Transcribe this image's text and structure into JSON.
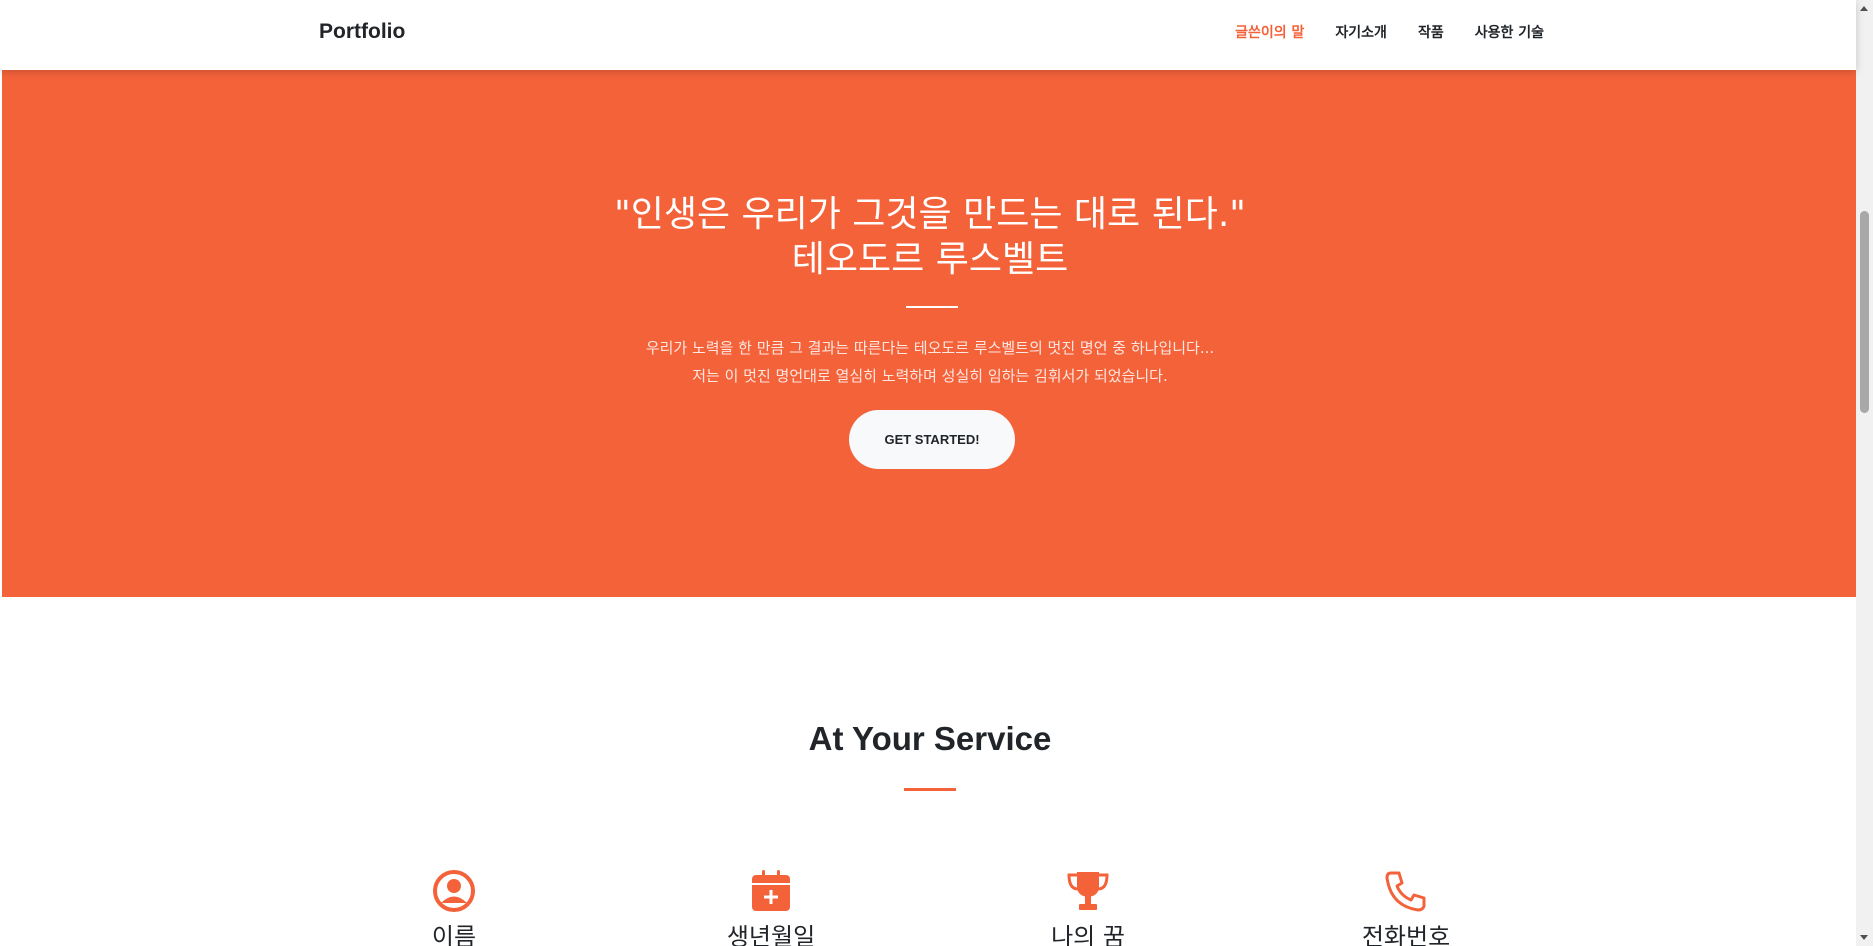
{
  "navbar": {
    "brand": "Portfolio",
    "links": [
      {
        "label": "글쓴이의 말",
        "active": true
      },
      {
        "label": "자기소개",
        "active": false
      },
      {
        "label": "작품",
        "active": false
      },
      {
        "label": "사용한 기술",
        "active": false
      }
    ]
  },
  "hero": {
    "title_line1": "\"인생은 우리가 그것을 만드는 대로 된다.\"",
    "title_line2": "테오도르 루스벨트",
    "text_line1": "우리가 노력을 한 만큼 그 결과는 따른다는 테오도르 루스벨트의 멋진 명언 중 하나입니다...",
    "text_line2": "저는 이 멋진 명언대로 열심히 노력하며 성실히 임하는 김휘서가 되었습니다.",
    "button_label": "GET STARTED!"
  },
  "services": {
    "title": "At Your Service",
    "items": [
      {
        "icon": "user-circle-icon",
        "label": "이름"
      },
      {
        "icon": "calendar-plus-icon",
        "label": "생년월일"
      },
      {
        "icon": "trophy-icon",
        "label": "나의 꿈"
      },
      {
        "icon": "phone-icon",
        "label": "전화번호"
      }
    ]
  },
  "colors": {
    "accent": "#f4623a",
    "text_dark": "#212529",
    "button_bg": "#f8f9fa"
  }
}
